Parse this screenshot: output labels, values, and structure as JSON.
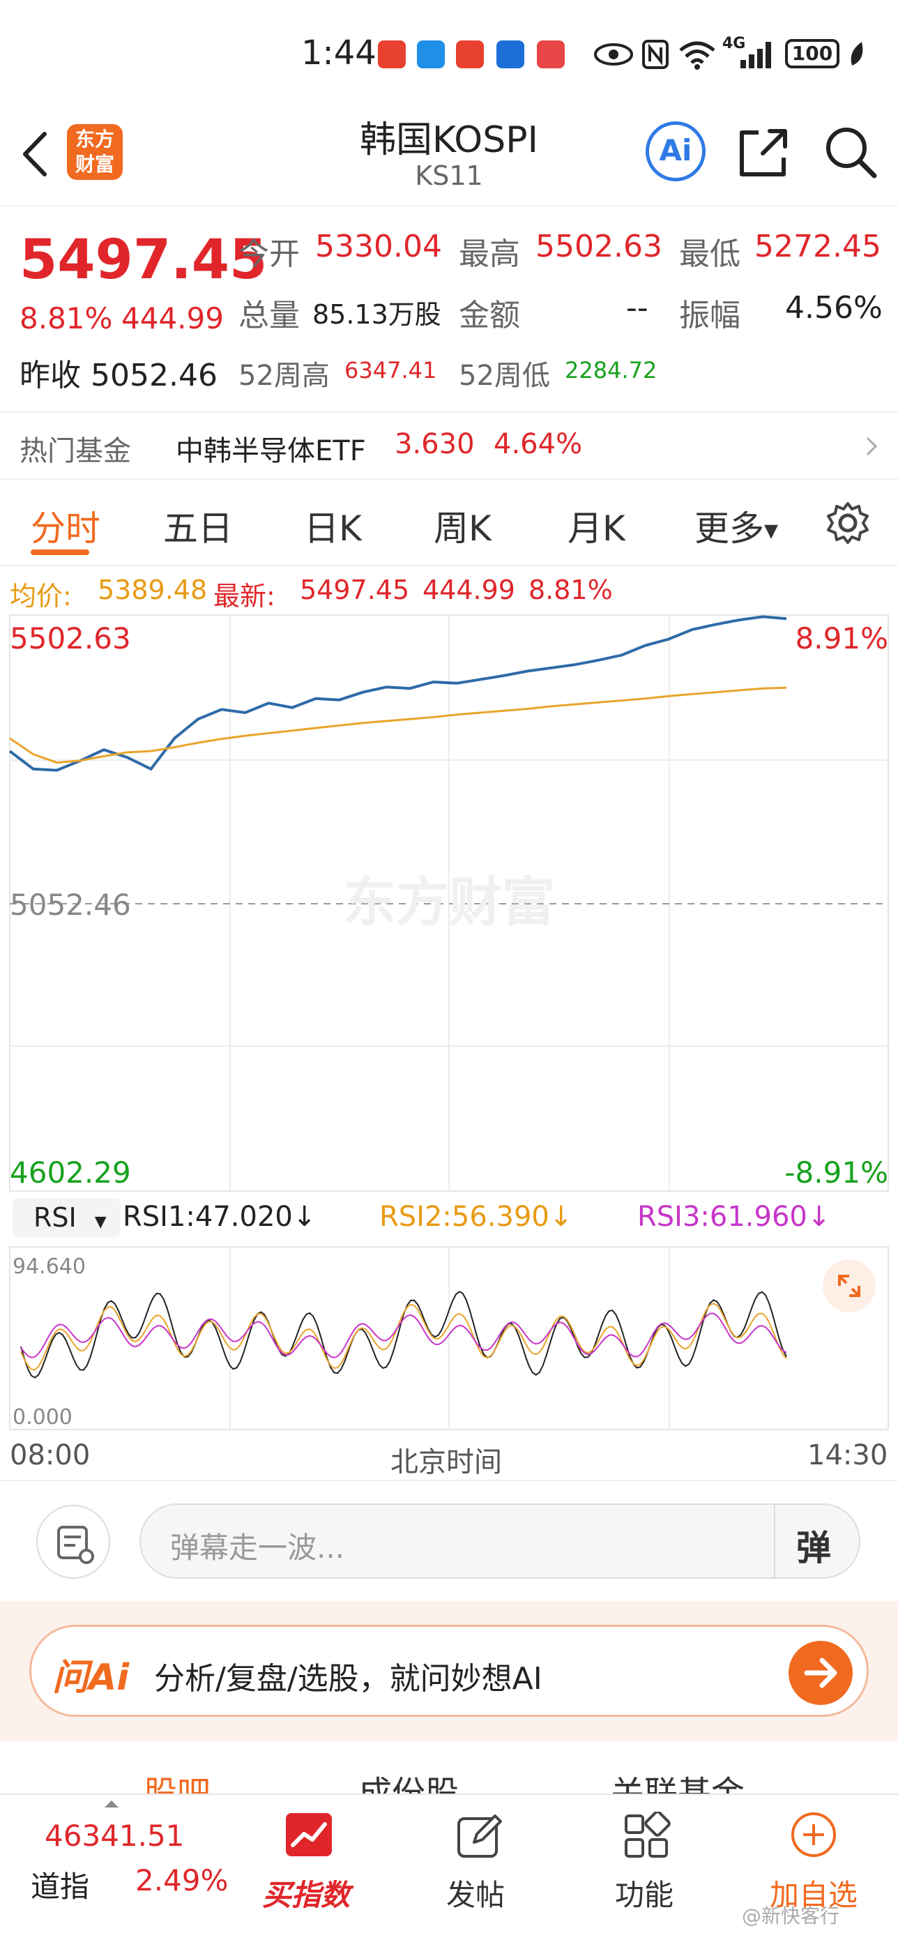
{
  "status_bar": {
    "time": "1:44",
    "network": "4G",
    "battery": "100"
  },
  "header": {
    "logo_text_line1": "东方",
    "logo_text_line2": "财富",
    "title": "韩国KOSPI",
    "code": "KS11",
    "ai_label": "Ai"
  },
  "quote": {
    "price": "5497.45",
    "change_pct": "8.81%",
    "change": "444.99",
    "open_label": "今开",
    "open": "5330.04",
    "high_label": "最高",
    "high": "5502.63",
    "low_label": "最低",
    "low": "5272.45",
    "volume_label": "总量",
    "volume": "85.13万股",
    "amount_label": "金额",
    "amount": "--",
    "amplitude_label": "振幅",
    "amplitude": "4.56%",
    "prev_close_label": "昨收",
    "prev_close": "5052.46",
    "high52_label": "52周高",
    "high52": "6347.41",
    "low52_label": "52周低",
    "low52": "2284.72"
  },
  "hot_fund": {
    "label": "热门基金",
    "name": "中韩半导体ETF",
    "price": "3.630",
    "pct": "4.64%"
  },
  "tabs": [
    {
      "label": "分时"
    },
    {
      "label": "五日"
    },
    {
      "label": "日K"
    },
    {
      "label": "周K"
    },
    {
      "label": "月K"
    },
    {
      "label": "更多"
    }
  ],
  "pricebar": {
    "avg_label": "均价:",
    "avg": "5389.48",
    "latest_label": "最新:",
    "latest": "5497.45",
    "change": "444.99",
    "pct": "8.81%"
  },
  "chart_labels": {
    "top_price": "5502.63",
    "top_pct": "8.91%",
    "mid_price": "5052.46",
    "bottom_price": "4602.29",
    "bottom_pct": "-8.91%",
    "watermark": "东方财富"
  },
  "rsi": {
    "selector": "RSI",
    "rsi1": "RSI1:47.020",
    "rsi2": "RSI2:56.390",
    "rsi3": "RSI3:61.960",
    "max": "94.640",
    "min": "0.000"
  },
  "time_axis": {
    "start": "08:00",
    "mid": "北京时间",
    "end": "14:30"
  },
  "danmu": {
    "placeholder": "弹幕走一波...",
    "button": "弹"
  },
  "ask_ai": {
    "brand": "问Ai",
    "text": "分析/复盘/选股，就问妙想AI"
  },
  "sub_tabs": [
    {
      "label": "股吧"
    },
    {
      "label": "成份股"
    },
    {
      "label": "关联基金"
    }
  ],
  "bottom_bar": {
    "index_value": "46341.51",
    "index_name": "道指",
    "index_pct": "2.49%",
    "items": [
      {
        "label": "买指数"
      },
      {
        "label": "发帖"
      },
      {
        "label": "功能"
      },
      {
        "label": "加自选"
      }
    ],
    "watermark": "@新快客行"
  },
  "colors": {
    "up": "#e0262a",
    "down": "#17a11e",
    "accent": "#f06a1f",
    "price_line": "#2e6aa8",
    "avg_line": "#e8a42a"
  },
  "chart_data": {
    "type": "line",
    "title": "",
    "ylim": [
      4602.29,
      5502.63
    ],
    "reference": 5052.46,
    "series": [
      {
        "values": [
          5290,
          5262,
          5260,
          5275,
          5292,
          5280,
          5262,
          5310,
          5340,
          5355,
          5350,
          5365,
          5358,
          5372,
          5370,
          5382,
          5390,
          5388,
          5398,
          5396,
          5402,
          5408,
          5415,
          5420,
          5425,
          5432,
          5440,
          5455,
          5465,
          5480,
          5488,
          5495,
          5500,
          5497
        ]
      },
      {
        "values": [
          5310,
          5285,
          5272,
          5275,
          5282,
          5288,
          5290,
          5296,
          5303,
          5309,
          5314,
          5318,
          5322,
          5326,
          5330,
          5334,
          5337,
          5340,
          5343,
          5347,
          5350,
          5353,
          5356,
          5360,
          5363,
          5366,
          5369,
          5372,
          5376,
          5379,
          5382,
          5385,
          5388,
          5389
        ]
      }
    ]
  }
}
